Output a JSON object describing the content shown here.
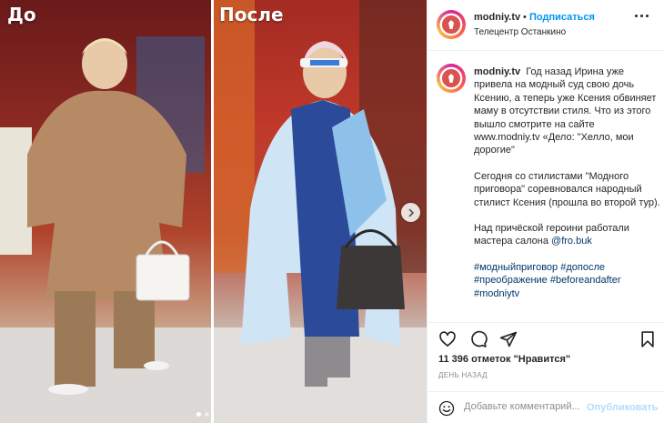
{
  "photos": {
    "before_label": "До",
    "after_label": "После"
  },
  "header": {
    "username": "modniy.tv",
    "separator": "•",
    "follow_label": "Подписаться",
    "location": "Телецентр Останкино"
  },
  "caption": {
    "username": "modniy.tv",
    "paragraph1": "Год назад Ирина уже привела на модный суд свою дочь Ксению, а теперь уже Ксения обвиняет маму в отсутствии стиля. Что из этого вышло смотрите на сайте www.modniy.tv «Дело: \"Хелло, мои дорогие\"",
    "paragraph2": "Сегодня со стилистами \"Модного приговора\" соревновался народный стилист Ксения (прошла во второй тур).",
    "paragraph3_text": "Над причёской героини работали мастера салона ",
    "paragraph3_mention": "@fro.buk",
    "hashtags": "#модныйприговор #допосле #преображение #beforeandafter #modniytv"
  },
  "stats": {
    "likes": "11 396 отметок \"Нравится\"",
    "time": "ДЕНЬ НАЗАД"
  },
  "comment": {
    "placeholder": "Добавьте комментарий...",
    "publish_label": "Опубликовать"
  },
  "colors": {
    "link": "#00376b",
    "follow": "#0095f6",
    "publish_disabled": "#b3dbff",
    "brand_avatar": "#d9534f"
  },
  "icons": {
    "like": "heart-icon",
    "comment": "comment-icon",
    "share": "paper-plane-icon",
    "save": "bookmark-icon",
    "more": "more-horizontal-icon",
    "emoji": "emoji-icon",
    "next": "chevron-right-icon"
  },
  "carousel": {
    "slide_count": 2,
    "active_slide": 1
  }
}
